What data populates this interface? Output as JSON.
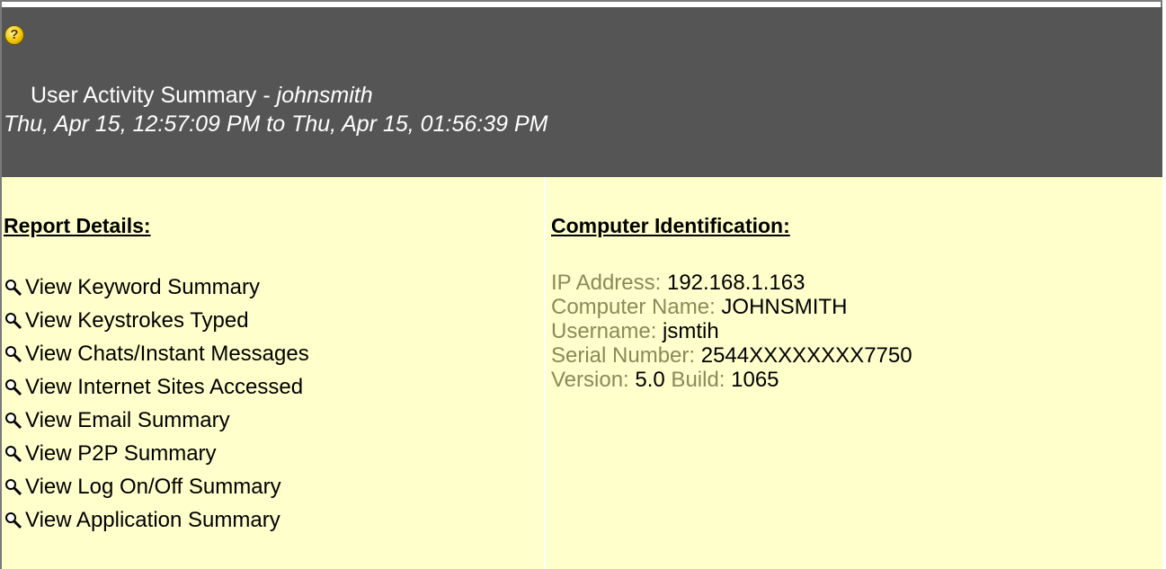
{
  "header": {
    "title_prefix": "User Activity Summary - ",
    "title_user": "johnsmith",
    "date_range": "Thu, Apr 15, 12:57:09 PM to Thu, Apr 15, 01:56:39 PM",
    "help_icon": "help-icon",
    "help_glyph": "?"
  },
  "report_details": {
    "heading": "Report Details:",
    "icon": "magnifier-icon",
    "links": [
      "View Keyword Summary",
      "View Keystrokes Typed",
      "View Chats/Instant Messages",
      "View Internet Sites Accessed",
      "View Email Summary",
      "View P2P Summary",
      "View Log On/Off Summary",
      "View Application Summary"
    ]
  },
  "computer_identification": {
    "heading": "Computer Identification:",
    "ip_label": "IP Address: ",
    "ip_value": "192.168.1.163",
    "name_label": "Computer Name: ",
    "name_value": "JOHNSMITH",
    "user_label": "Username: ",
    "user_value": "jsmtih",
    "serial_label": "Serial Number: ",
    "serial_value": "2544XXXXXXXX7750",
    "version_label": "Version: ",
    "version_value": "5.0",
    "build_label": " Build: ",
    "build_value": "1065"
  },
  "colors": {
    "header_bg": "#555555",
    "body_bg": "#ffffcc",
    "label_color": "#8a8a5a"
  }
}
